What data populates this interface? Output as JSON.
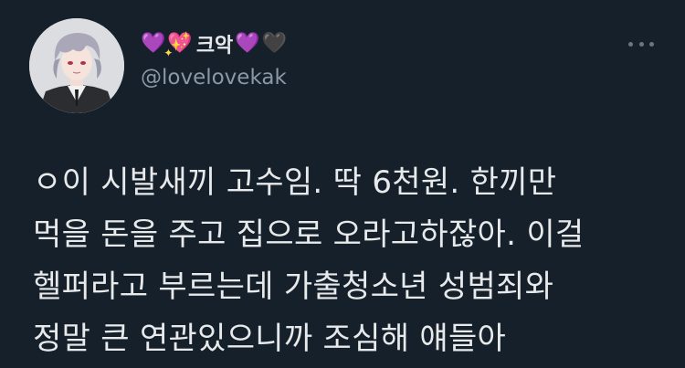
{
  "tweet": {
    "display_name": {
      "prefix_emojis": [
        "💜",
        "💖"
      ],
      "text": "크악",
      "suffix_emojis": [
        "💜",
        "🖤"
      ]
    },
    "handle": "@lovelovekak",
    "body_lines": [
      "ㅇ이 시발새끼 고수임. 딱 6천원. 한끼만",
      "먹을 돈을 주고 집으로 오라고하잖아. 이걸",
      "헬퍼라고 부르는데 가출청소년 성범죄와",
      "정말 큰 연관있으니까 조심해 얘들아"
    ]
  },
  "icons": {
    "more": "more-horizontal-icon",
    "avatar": "profile-avatar"
  },
  "colors": {
    "background": "#15202b",
    "text": "#e7e9ea",
    "secondary": "#8b98a5"
  }
}
